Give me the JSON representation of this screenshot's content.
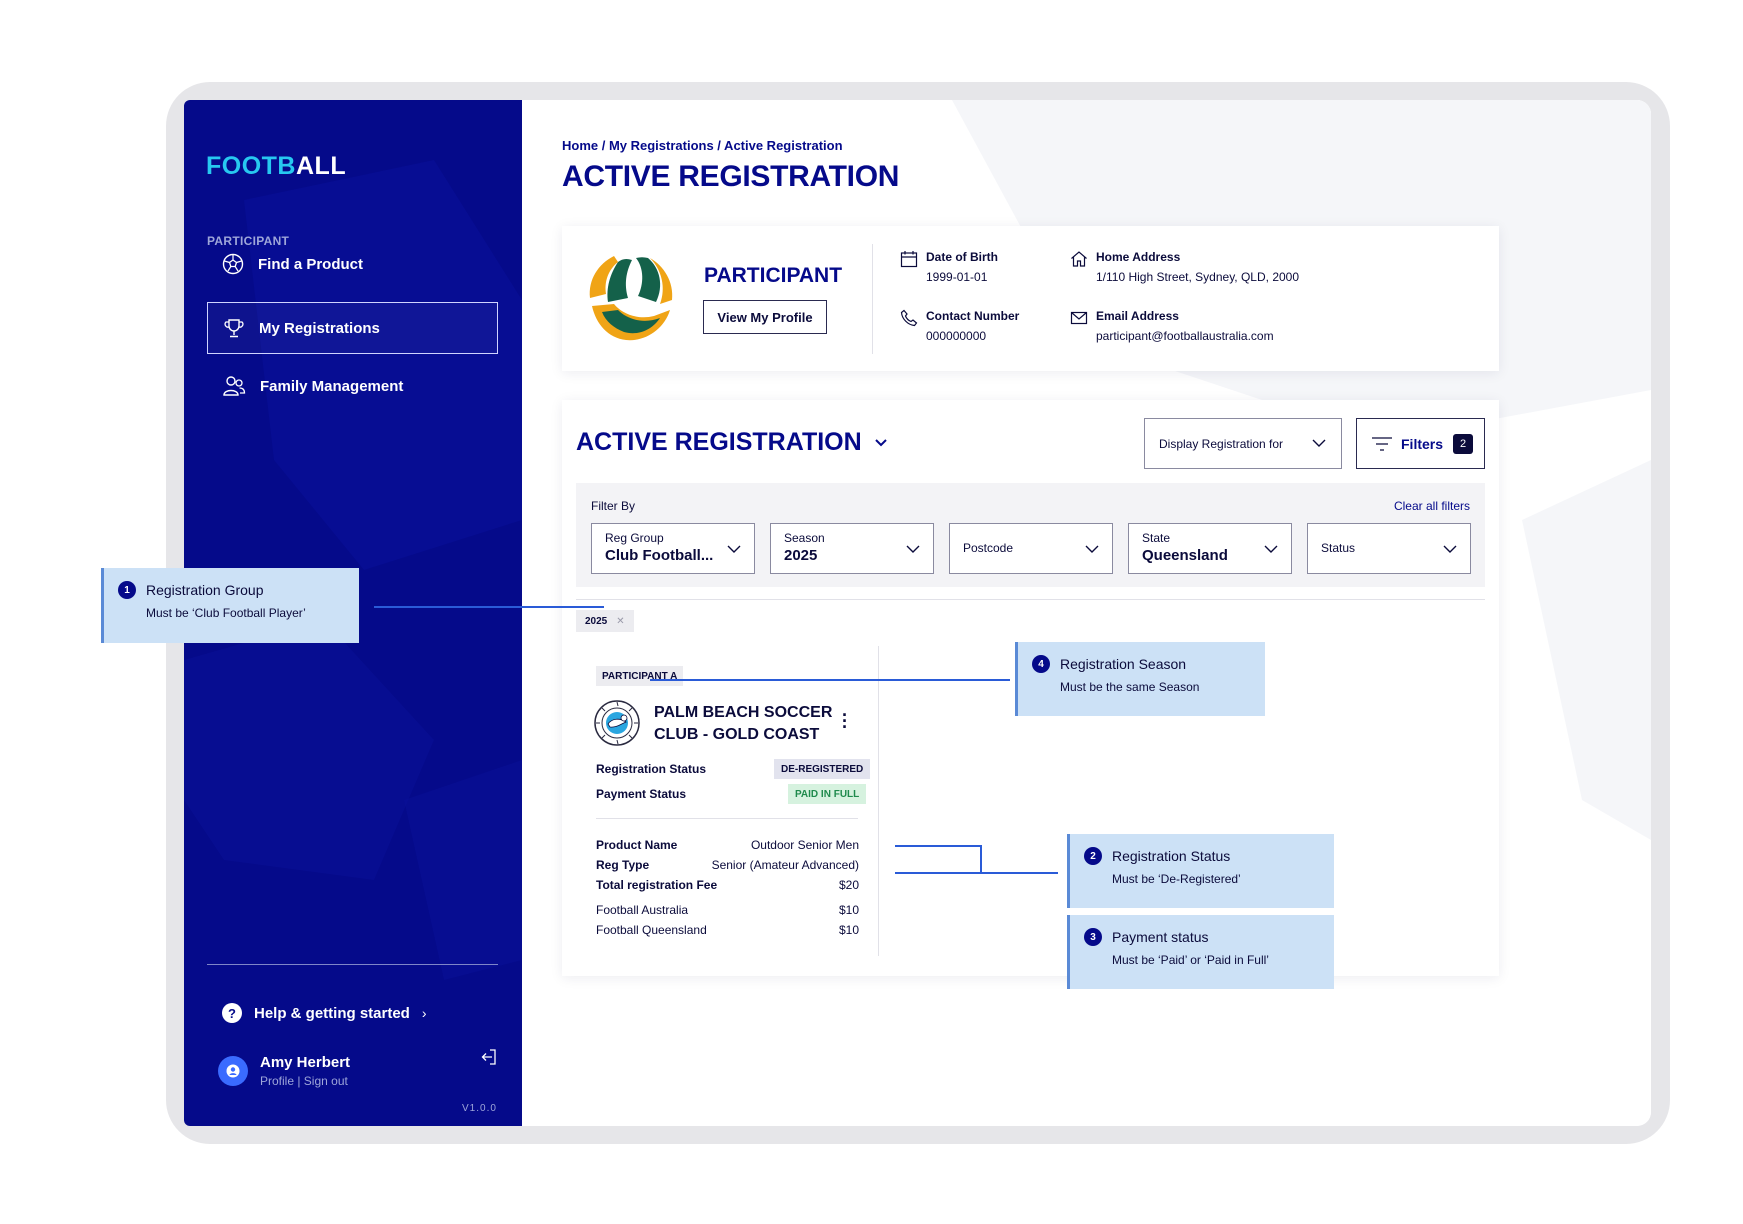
{
  "sidebar": {
    "logo_part1": "FOOTB",
    "logo_part2": "ALL",
    "section_label": "PARTICIPANT",
    "items": [
      {
        "label": "Find a Product",
        "icon": "soccer-ball-icon"
      },
      {
        "label": "My Registrations",
        "icon": "trophy-icon",
        "active": true
      },
      {
        "label": "Family Management",
        "icon": "people-icon"
      }
    ],
    "help_label": "Help & getting started",
    "user_name": "Amy Herbert",
    "user_links": "Profile | Sign out",
    "version": "V1.0.0"
  },
  "header": {
    "breadcrumb": "Home / My Registrations / Active Registration",
    "title": "ACTIVE REGISTRATION"
  },
  "profile": {
    "title": "PARTICIPANT",
    "view_button": "View My Profile",
    "dob_label": "Date of Birth",
    "dob_value": "1999-01-01",
    "contact_label": "Contact Number",
    "contact_value": "000000000",
    "address_label": "Home Address",
    "address_value": "1/110 High Street, Sydney, QLD, 2000",
    "email_label": "Email Address",
    "email_value": "participant@footballaustralia.com"
  },
  "registration": {
    "title": "ACTIVE REGISTRATION",
    "display_dropdown": "Display Registration for",
    "filters_label": "Filters",
    "filters_count": "2",
    "filter_by": "Filter By",
    "clear_all": "Clear all filters",
    "filters": [
      {
        "label": "Reg Group",
        "value": "Club Football..."
      },
      {
        "label": "Season",
        "value": "2025"
      },
      {
        "label": "Postcode",
        "value": ""
      },
      {
        "label": "State",
        "value": "Queensland"
      },
      {
        "label": "Status",
        "value": ""
      }
    ],
    "chip": "2025",
    "participant_tag": "PARTICIPANT A",
    "club_name": "PALM BEACH SOCCER CLUB - GOLD COAST",
    "reg_status_label": "Registration Status",
    "reg_status_value": "DE-REGISTERED",
    "payment_status_label": "Payment Status",
    "payment_status_value": "PAID IN FULL",
    "details": [
      {
        "label": "Product Name",
        "value": "Outdoor Senior Men"
      },
      {
        "label": "Reg Type",
        "value": "Senior (Amateur Advanced)"
      },
      {
        "label": "Total registration Fee",
        "value": "$20"
      }
    ],
    "fees": [
      {
        "label": "Football Australia",
        "value": "$10"
      },
      {
        "label": "Football Queensland",
        "value": "$10"
      }
    ]
  },
  "callouts": [
    {
      "num": "1",
      "title": "Registration Group",
      "sub": "Must be ‘Club Football Player’"
    },
    {
      "num": "2",
      "title": "Registration Status",
      "sub": "Must be ‘De-Registered’"
    },
    {
      "num": "3",
      "title": "Payment status",
      "sub": "Must be ‘Paid’ or ‘Paid in Full’"
    },
    {
      "num": "4",
      "title": "Registration Season",
      "sub": "Must be the same Season"
    }
  ],
  "colors": {
    "sidebar": "#050a8a",
    "accent": "#27c8f0",
    "callout": "#cce1f6",
    "connector": "#2a5bd7"
  }
}
